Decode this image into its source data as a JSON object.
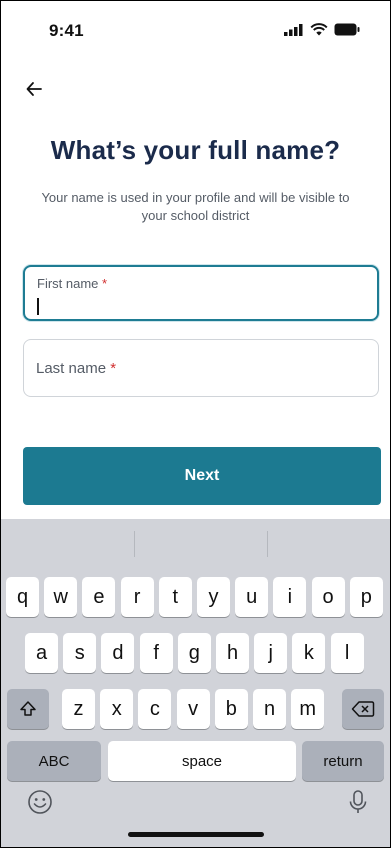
{
  "status_bar": {
    "time": "9:41"
  },
  "header": {
    "back_icon": "arrow-left-icon"
  },
  "main": {
    "title": "What’s your full name?",
    "subtitle": "Your name is used in your profile and will be visible to your school district",
    "first_name": {
      "label": "First name",
      "required_mark": "*",
      "value": ""
    },
    "last_name": {
      "label": "Last name",
      "required_mark": "*",
      "value": ""
    },
    "next_label": "Next"
  },
  "keyboard": {
    "row1": [
      "q",
      "w",
      "e",
      "r",
      "t",
      "y",
      "u",
      "i",
      "o",
      "p"
    ],
    "row2": [
      "a",
      "s",
      "d",
      "f",
      "g",
      "h",
      "j",
      "k",
      "l"
    ],
    "row3": [
      "z",
      "x",
      "c",
      "v",
      "b",
      "n",
      "m"
    ],
    "abc_label": "ABC",
    "space_label": "space",
    "return_label": "return",
    "shift_icon": "shift-icon",
    "delete_icon": "delete-icon",
    "emoji_icon": "emoji-icon",
    "mic_icon": "microphone-icon"
  },
  "colors": {
    "primary": "#1c7a91",
    "title": "#1b2b4b",
    "required": "#d12f2f"
  }
}
